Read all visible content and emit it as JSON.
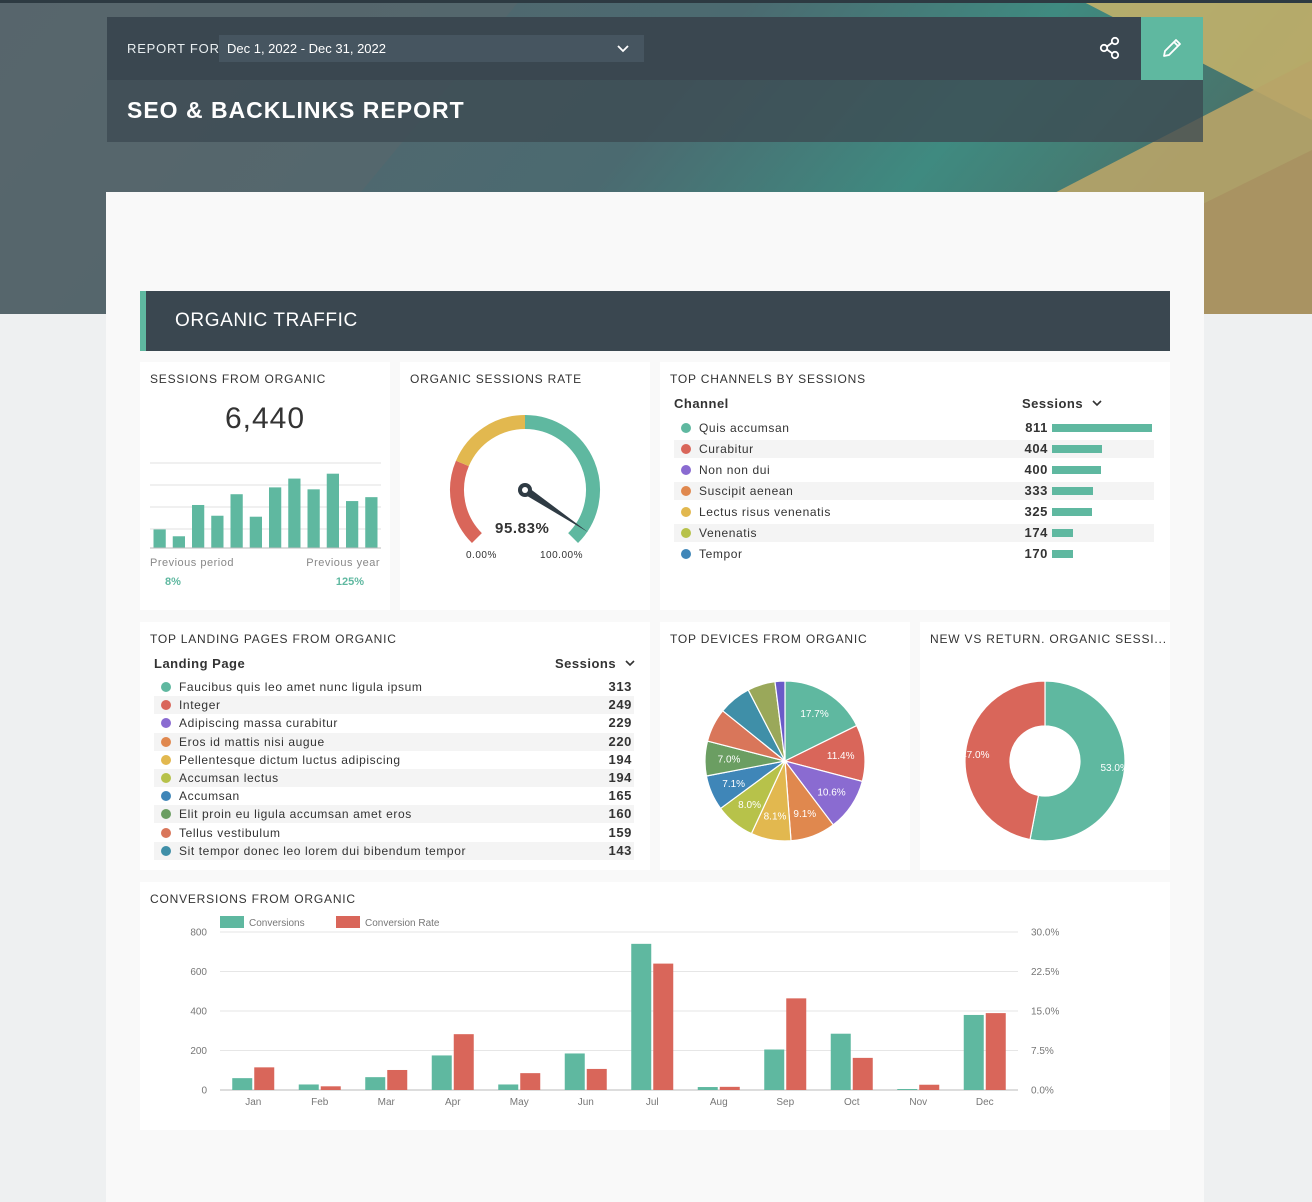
{
  "header": {
    "report_for_label": "REPORT FOR",
    "date_range": "Dec 1, 2022 - Dec 31, 2022",
    "title": "SEO & BACKLINKS REPORT",
    "icons": {
      "date_dropdown": "chevron-down-icon",
      "share": "share-icon",
      "edit": "pencil-icon"
    },
    "accent_color": "#5fb8a0"
  },
  "section": {
    "title": "ORGANIC TRAFFIC"
  },
  "sessions_from_organic": {
    "title": "SESSIONS FROM ORGANIC",
    "value": "6,440",
    "previous_period_label": "Previous period",
    "previous_period_change": "8%",
    "previous_year_label": "Previous year",
    "previous_year_change": "125%",
    "sparkline": [
      19,
      12,
      44,
      33,
      55,
      32,
      62,
      71,
      60,
      76,
      48,
      52
    ]
  },
  "organic_sessions_rate": {
    "title": "ORGANIC SESSIONS RATE",
    "value": "95.83%",
    "value_number": 95.83,
    "min_label": "0.00%",
    "max_label": "100.00%"
  },
  "top_channels": {
    "title": "TOP CHANNELS BY SESSIONS",
    "col_channel": "Channel",
    "col_sessions": "Sessions",
    "rows": [
      {
        "label": "Quis accumsan",
        "value": "811",
        "num": 811,
        "color": "#5fb8a0"
      },
      {
        "label": "Curabitur",
        "value": "404",
        "num": 404,
        "color": "#d9665a"
      },
      {
        "label": "Non non dui",
        "value": "400",
        "num": 400,
        "color": "#8a6bd1"
      },
      {
        "label": "Suscipit aenean",
        "value": "333",
        "num": 333,
        "color": "#e0884e"
      },
      {
        "label": "Lectus risus venenatis",
        "value": "325",
        "num": 325,
        "color": "#e2b84f"
      },
      {
        "label": "Venenatis",
        "value": "174",
        "num": 174,
        "color": "#b7c24a"
      },
      {
        "label": "Tempor",
        "value": "170",
        "num": 170,
        "color": "#3f86b8"
      }
    ]
  },
  "top_landing_pages": {
    "title": "TOP LANDING PAGES FROM ORGANIC",
    "col_page": "Landing Page",
    "col_sessions": "Sessions",
    "rows": [
      {
        "label": "Faucibus quis leo amet nunc ligula ipsum",
        "value": "313",
        "color": "#5fb8a0"
      },
      {
        "label": "Integer",
        "value": "249",
        "color": "#d9665a"
      },
      {
        "label": "Adipiscing massa curabitur",
        "value": "229",
        "color": "#8a6bd1"
      },
      {
        "label": "Eros id mattis nisi augue",
        "value": "220",
        "color": "#e0884e"
      },
      {
        "label": "Pellentesque dictum luctus adipiscing",
        "value": "194",
        "color": "#e2b84f"
      },
      {
        "label": "Accumsan lectus",
        "value": "194",
        "color": "#b7c24a"
      },
      {
        "label": "Accumsan",
        "value": "165",
        "color": "#3f86b8"
      },
      {
        "label": "Elit proin eu ligula accumsan amet eros",
        "value": "160",
        "color": "#6b9e62"
      },
      {
        "label": "Tellus vestibulum",
        "value": "159",
        "color": "#d9765a"
      },
      {
        "label": "Sit tempor donec leo lorem dui bibendum tempor",
        "value": "143",
        "color": "#3f8fa8"
      }
    ]
  },
  "top_devices": {
    "title": "TOP DEVICES FROM ORGANIC",
    "slices": [
      {
        "label": "17.7%",
        "value": 17.7,
        "color": "#5fb8a0"
      },
      {
        "label": "11.4%",
        "value": 11.4,
        "color": "#d9665a"
      },
      {
        "label": "10.6%",
        "value": 10.6,
        "color": "#8a6bd1"
      },
      {
        "label": "9.1%",
        "value": 9.1,
        "color": "#e0884e"
      },
      {
        "label": "8.1%",
        "value": 8.1,
        "color": "#e2b84f"
      },
      {
        "label": "8.0%",
        "value": 8.0,
        "color": "#b7c24a"
      },
      {
        "label": "7.1%",
        "value": 7.1,
        "color": "#3f86b8"
      },
      {
        "label": "7.0%",
        "value": 7.0,
        "color": "#6b9e62"
      },
      {
        "label": "",
        "value": 6.8,
        "color": "#d9765a"
      },
      {
        "label": "",
        "value": 6.6,
        "color": "#3f8fa8"
      },
      {
        "label": "",
        "value": 5.6,
        "color": "#9aa85a"
      },
      {
        "label": "",
        "value": 2.0,
        "color": "#6a5bc8"
      }
    ]
  },
  "new_vs_return": {
    "title": "NEW VS RETURN. ORGANIC SESSI...",
    "slices": [
      {
        "label": "53.0%",
        "value": 53.0,
        "color": "#5fb8a0"
      },
      {
        "label": "47.0%",
        "value": 47.0,
        "color": "#d9665a"
      }
    ]
  },
  "chart_data": {
    "type": "bar",
    "title": "CONVERSIONS FROM ORGANIC",
    "categories": [
      "Jan",
      "Feb",
      "Mar",
      "Apr",
      "May",
      "Jun",
      "Jul",
      "Aug",
      "Sep",
      "Oct",
      "Nov",
      "Dec"
    ],
    "series": [
      {
        "name": "Conversions",
        "axis": "left",
        "color": "#5fb8a0",
        "values": [
          60,
          28,
          65,
          175,
          28,
          185,
          740,
          15,
          205,
          285,
          5,
          380
        ]
      },
      {
        "name": "Conversion Rate",
        "axis": "right",
        "color": "#d9665a",
        "values": [
          4.3,
          0.7,
          3.8,
          10.6,
          3.2,
          4.0,
          24.0,
          0.6,
          17.4,
          6.1,
          1.0,
          14.6
        ]
      }
    ],
    "y_left_ticks": [
      "0",
      "200",
      "400",
      "600",
      "800"
    ],
    "y_left_lim": [
      0,
      800
    ],
    "y_right_ticks": [
      "0.0%",
      "7.5%",
      "15.0%",
      "22.5%",
      "30.0%"
    ],
    "y_right_lim": [
      0,
      30
    ],
    "grid": true,
    "legend": "top-left"
  }
}
